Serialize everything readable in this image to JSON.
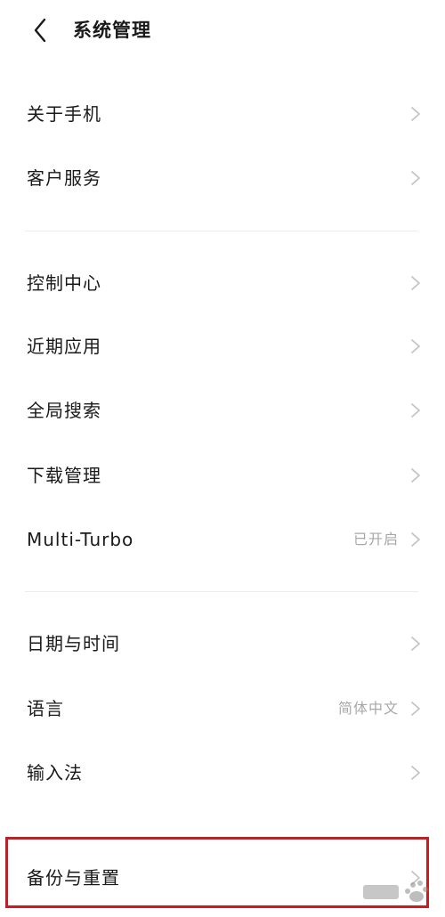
{
  "header": {
    "title": "系统管理",
    "back_icon": "chevron-left-icon"
  },
  "groups": [
    {
      "items": [
        {
          "label": "关于手机",
          "value": ""
        },
        {
          "label": "客户服务",
          "value": ""
        }
      ]
    },
    {
      "items": [
        {
          "label": "控制中心",
          "value": ""
        },
        {
          "label": "近期应用",
          "value": ""
        },
        {
          "label": "全局搜索",
          "value": ""
        },
        {
          "label": "下载管理",
          "value": ""
        },
        {
          "label": "Multi-Turbo",
          "value": "已开启"
        }
      ]
    },
    {
      "items": [
        {
          "label": "日期与时间",
          "value": ""
        },
        {
          "label": "语言",
          "value": "简体中文"
        },
        {
          "label": "输入法",
          "value": ""
        }
      ]
    },
    {
      "items": [
        {
          "label": "备份与重置",
          "value": ""
        }
      ]
    }
  ],
  "colors": {
    "highlight": "#c21f25",
    "text": "#1a1a1a",
    "secondary": "#a8a8a8",
    "chevron": "#c4c4c4"
  },
  "row_icon": "chevron-right-icon",
  "watermark_icon": "baidu-watermark-icon"
}
